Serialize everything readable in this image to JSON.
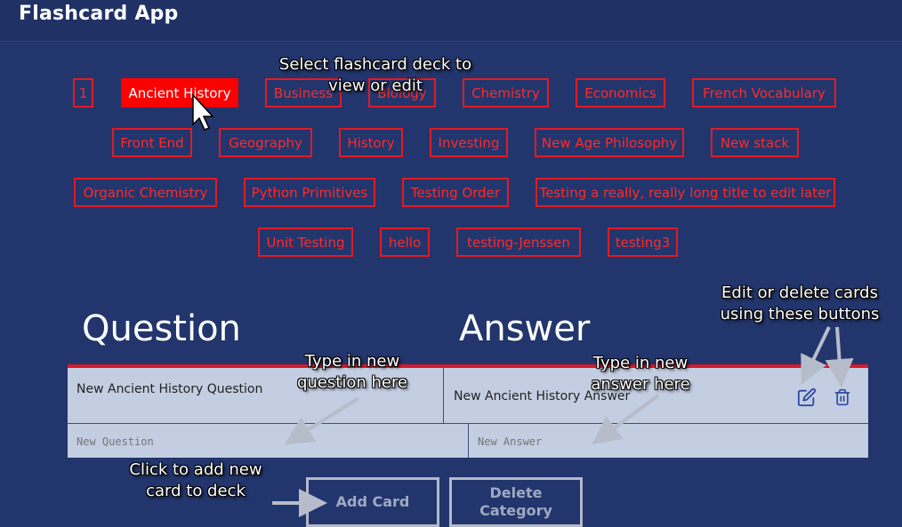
{
  "app": {
    "title": "Flashcard App"
  },
  "decks": [
    "1",
    "Ancient History",
    "Business",
    "Biology",
    "Chemistry",
    "Economics",
    "French Vocabulary",
    "Front End",
    "Geography",
    "History",
    "Investing",
    "New Age Philosophy",
    "New stack",
    "Organic Chemistry",
    "Python Primitives",
    "Testing Order",
    "Testing a really, really long title to edit later",
    "Unit Testing",
    "hello",
    "testing-Jenssen",
    "testing3"
  ],
  "selected_deck": "Ancient History",
  "table": {
    "question_header": "Question",
    "answer_header": "Answer",
    "rows": [
      {
        "question": "New Ancient History Question",
        "answer": "New Ancient History Answer"
      }
    ],
    "new_question_placeholder": "New Question",
    "new_answer_placeholder": "New Answer"
  },
  "buttons": {
    "add_card": "Add Card",
    "delete_category": "Delete Category"
  },
  "annotations": {
    "select_deck": "Select flashcard deck to view or edit",
    "edit_delete": "Edit or delete cards using these buttons",
    "type_question": "Type in new question here",
    "type_answer": "Type in new answer here",
    "add_card": "Click to add new card to deck"
  },
  "icons": {
    "edit": "edit-icon",
    "delete": "trash-icon",
    "cursor": "mouse-pointer-icon"
  },
  "colors": {
    "background": "#22356c",
    "accent": "#e01b24",
    "table": "#c4cee2"
  }
}
